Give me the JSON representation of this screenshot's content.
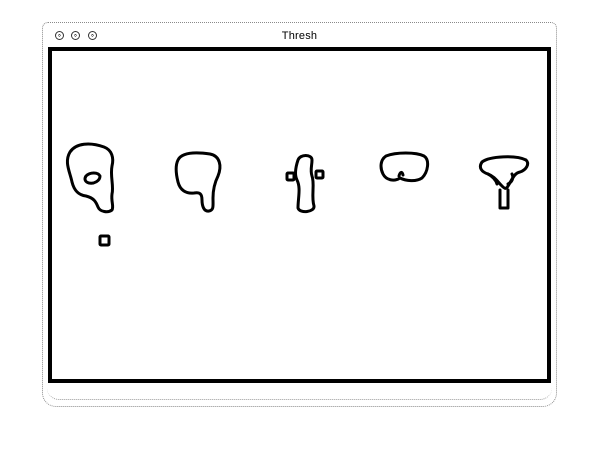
{
  "window": {
    "title": "Thresh"
  },
  "titlebar": {
    "buttons": [
      {
        "name": "close-button",
        "icon": "close-icon"
      },
      {
        "name": "minimize-button",
        "icon": "minimize-icon"
      },
      {
        "name": "zoom-button",
        "icon": "zoom-icon"
      }
    ]
  },
  "canvas": {
    "background": "#ffffff",
    "stroke_color": "#000000",
    "shapes": [
      "blob-1",
      "blob-2",
      "blob-3",
      "blob-4",
      "blob-5",
      "small-square"
    ]
  }
}
